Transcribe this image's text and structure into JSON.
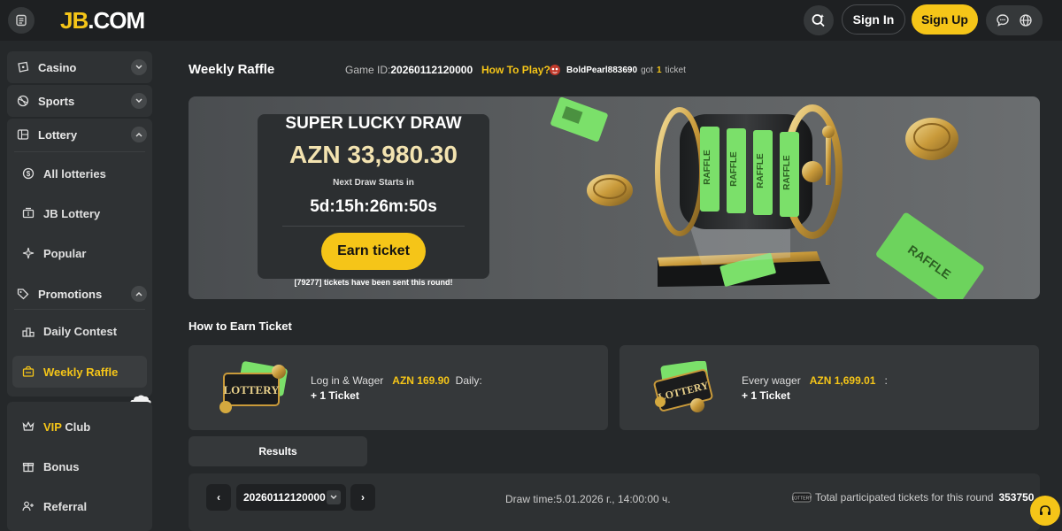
{
  "header": {
    "logo_jb": "JB",
    "logo_com": ".COM",
    "signin_label": "Sign In",
    "signup_label": "Sign Up"
  },
  "sidebar": {
    "casino": "Casino",
    "sports": "Sports",
    "lottery": "Lottery",
    "lottery_items": [
      "All lotteries",
      "JB Lottery",
      "Popular"
    ],
    "promotions": "Promotions",
    "promo_items": [
      "Daily Contest",
      "Weekly Raffle"
    ],
    "more_items": [
      "VIP Club",
      "Bonus",
      "Referral"
    ]
  },
  "page": {
    "title": "Weekly Raffle",
    "game_id_label": "Game ID:",
    "game_id": "20260112120000",
    "how_to_play": "How To Play?",
    "ticker_user": "BoldPearl883690",
    "ticker_got": "got",
    "ticker_num": "1",
    "ticker_unit": "ticket"
  },
  "banner": {
    "headline": "SUPER LUCKY DRAW",
    "amount": "AZN 33,980.30",
    "next_label": "Next Draw Starts in",
    "countdown": "5d:15h:26m:50s",
    "earn_button": "Earn ticket",
    "sent_text": "[79277] tickets have been sent this round!",
    "raffle_word": "RAFFLE"
  },
  "earn": {
    "title": "How to Earn Ticket",
    "card1_prefix": "Log in & Wager",
    "card1_amount": "AZN 169.90",
    "card1_suffix": "Daily:",
    "card1_reward": "+ 1 Ticket",
    "card2_prefix": "Every wager",
    "card2_amount": "AZN 1,699.01",
    "card2_suffix": ":",
    "card2_reward": "+ 1 Ticket",
    "lottery_word": "LOTTERY"
  },
  "results": {
    "tab_label": "Results",
    "prev": "‹",
    "next": "›",
    "selected_id": "20260112120000",
    "draw_time": "Draw time:5.01.2026 г., 14:00:00 ч.",
    "total_label": "Total participated tickets for this round",
    "total_value": "353750"
  },
  "colors": {
    "accent": "#f5c518",
    "bg": "#25282a",
    "panel": "#35383a"
  }
}
